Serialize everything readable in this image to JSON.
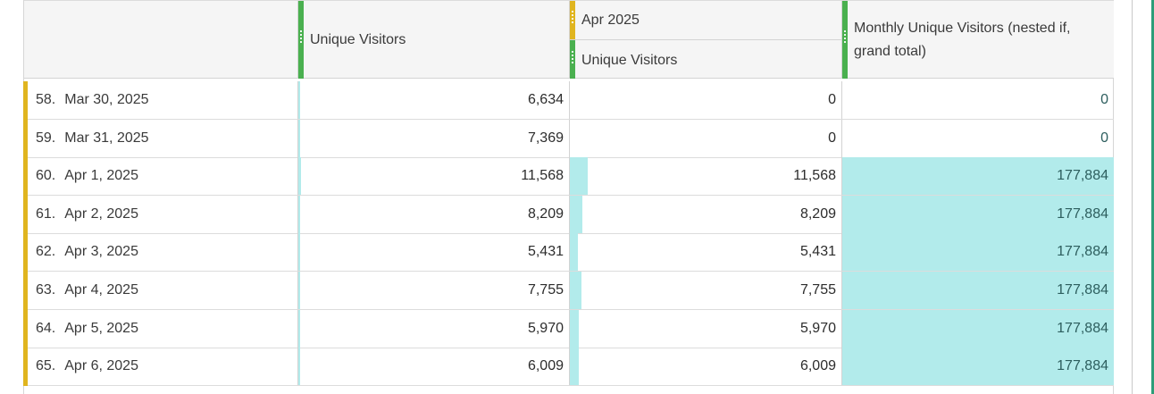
{
  "header": {
    "col1_title": "Unique Visitors",
    "col2_group": "Apr 2025",
    "col2_title": "Unique Visitors",
    "col3_title_line1": "Monthly Unique Visitors (nested if,",
    "col3_title_line2": "grand total)"
  },
  "colors": {
    "metric_bar": "#4ab04f",
    "segment_bar": "#e0b51f",
    "cell_fill": "#b2ebeb"
  },
  "rows": [
    {
      "index": "58.",
      "date": "Mar 30, 2025",
      "unique_visitors": "6,634",
      "apr_unique_visitors": "0",
      "monthly_unique": "0",
      "uv_fraction": 0.006,
      "apr_fraction": 0,
      "monthly_fill": false
    },
    {
      "index": "59.",
      "date": "Mar 31, 2025",
      "unique_visitors": "7,369",
      "apr_unique_visitors": "0",
      "monthly_unique": "0",
      "uv_fraction": 0.007,
      "apr_fraction": 0,
      "monthly_fill": false
    },
    {
      "index": "60.",
      "date": "Apr 1, 2025",
      "unique_visitors": "11,568",
      "apr_unique_visitors": "11,568",
      "monthly_unique": "177,884",
      "uv_fraction": 0.01,
      "apr_fraction": 0.065,
      "monthly_fill": true
    },
    {
      "index": "61.",
      "date": "Apr 2, 2025",
      "unique_visitors": "8,209",
      "apr_unique_visitors": "8,209",
      "monthly_unique": "177,884",
      "uv_fraction": 0.007,
      "apr_fraction": 0.046,
      "monthly_fill": true
    },
    {
      "index": "62.",
      "date": "Apr 3, 2025",
      "unique_visitors": "5,431",
      "apr_unique_visitors": "5,431",
      "monthly_unique": "177,884",
      "uv_fraction": 0.005,
      "apr_fraction": 0.031,
      "monthly_fill": true
    },
    {
      "index": "63.",
      "date": "Apr 4, 2025",
      "unique_visitors": "7,755",
      "apr_unique_visitors": "7,755",
      "monthly_unique": "177,884",
      "uv_fraction": 0.007,
      "apr_fraction": 0.044,
      "monthly_fill": true
    },
    {
      "index": "64.",
      "date": "Apr 5, 2025",
      "unique_visitors": "5,970",
      "apr_unique_visitors": "5,970",
      "monthly_unique": "177,884",
      "uv_fraction": 0.005,
      "apr_fraction": 0.034,
      "monthly_fill": true
    },
    {
      "index": "65.",
      "date": "Apr 6, 2025",
      "unique_visitors": "6,009",
      "apr_unique_visitors": "6,009",
      "monthly_unique": "177,884",
      "uv_fraction": 0.005,
      "apr_fraction": 0.034,
      "monthly_fill": true
    }
  ]
}
